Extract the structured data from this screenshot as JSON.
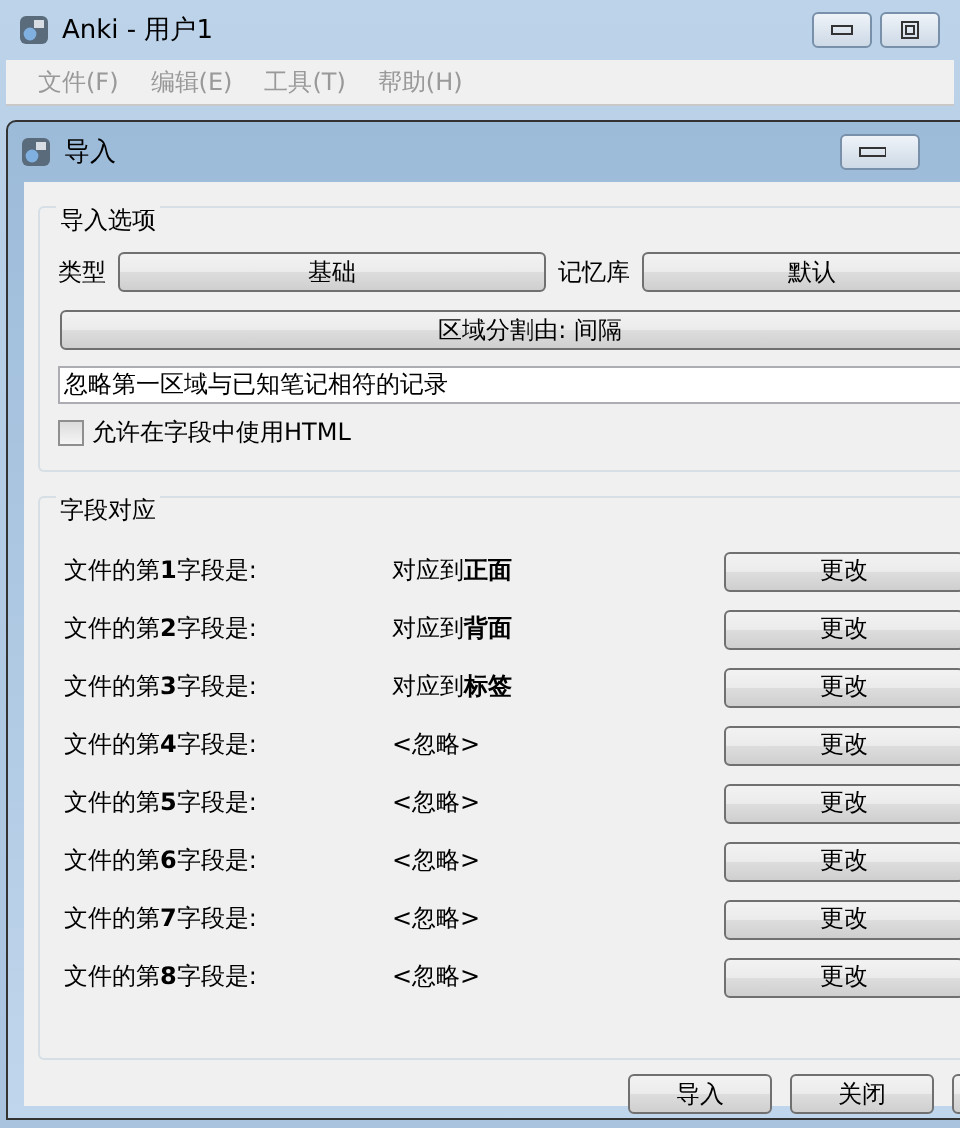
{
  "main_window": {
    "title": "Anki - 用户1",
    "menu": [
      "文件(F)",
      "编辑(E)",
      "工具(T)",
      "帮助(H)"
    ]
  },
  "dialog": {
    "title": "导入",
    "import_options": {
      "title": "导入选项",
      "type_label": "类型",
      "type_value": "基础",
      "deck_label": "记忆库",
      "deck_value": "默认",
      "separator_button": "区域分割由: 间隔",
      "duplicate_option": "忽略第一区域与已知笔记相符的记录",
      "allow_html": {
        "label": "允许在字段中使用HTML",
        "checked": false
      }
    },
    "field_mapping": {
      "title": "字段对应",
      "rows": [
        {
          "label": "文件的第**1**字段是:",
          "target": "对应到**正面**",
          "button": "更改"
        },
        {
          "label": "文件的第**2**字段是:",
          "target": "对应到**背面**",
          "button": "更改"
        },
        {
          "label": "文件的第**3**字段是:",
          "target": "对应到**标签**",
          "button": "更改"
        },
        {
          "label": "文件的第**4**字段是:",
          "target": "<忽略>",
          "button": "更改"
        },
        {
          "label": "文件的第**5**字段是:",
          "target": "<忽略>",
          "button": "更改"
        },
        {
          "label": "文件的第**6**字段是:",
          "target": "<忽略>",
          "button": "更改"
        },
        {
          "label": "文件的第**7**字段是:",
          "target": "<忽略>",
          "button": "更改"
        },
        {
          "label": "文件的第**8**字段是:",
          "target": "<忽略>",
          "button": "更改"
        }
      ]
    },
    "buttons": [
      "导入",
      "关闭"
    ]
  }
}
